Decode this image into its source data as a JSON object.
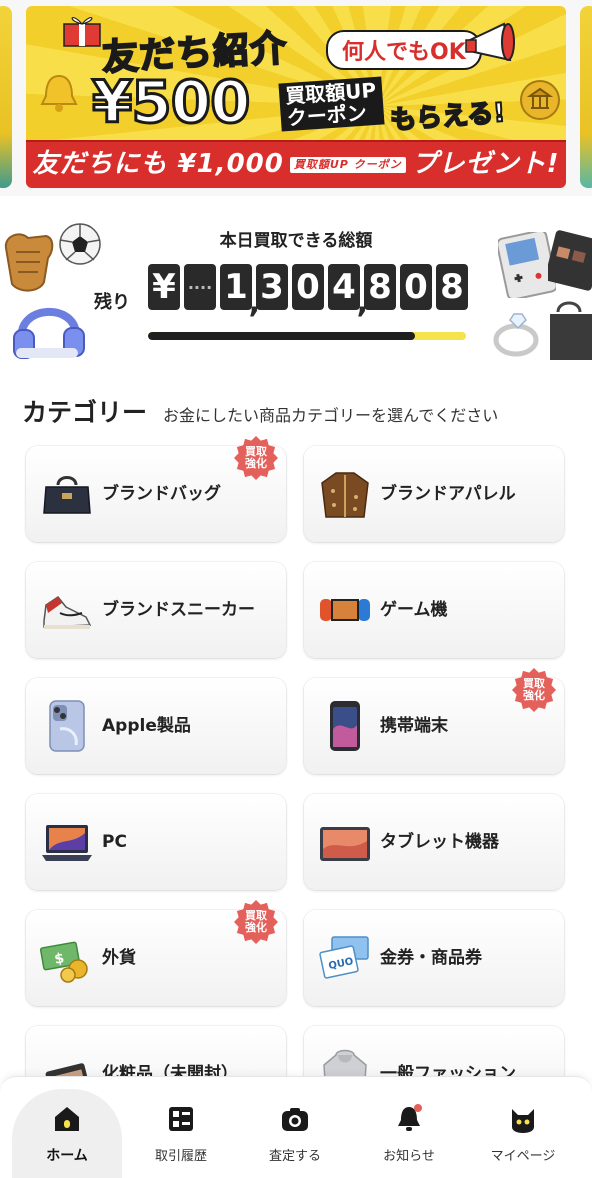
{
  "banner": {
    "headline": "友だち紹介",
    "pill": "何人でもOK",
    "amount": "¥500",
    "coupon_tag_line1": "買取額UP",
    "coupon_tag_line2": "クーポン",
    "receive": "もらえる!",
    "ribbon_prefix": "友だちにも ¥1,000",
    "ribbon_tag": "買取額UP クーポン",
    "ribbon_suffix": "プレゼント!"
  },
  "totals": {
    "title": "本日買取できる総額",
    "remaining_label": "残り",
    "digits": [
      "¥",
      "····",
      "1",
      "3",
      "0",
      "4",
      "8",
      "0",
      "8"
    ],
    "progress_fraction": 0.84
  },
  "category": {
    "title": "カテゴリー",
    "subtitle": "お金にしたい商品カテゴリーを選んでください",
    "badge_line1": "買取",
    "badge_line2": "強化",
    "items": [
      {
        "label": "ブランドバッグ",
        "icon": "handbag-icon",
        "badge": true
      },
      {
        "label": "ブランドアパレル",
        "icon": "jacket-icon",
        "badge": false
      },
      {
        "label": "ブランドスニーカー",
        "icon": "sneaker-icon",
        "badge": false
      },
      {
        "label": "ゲーム機",
        "icon": "game-console-icon",
        "badge": false
      },
      {
        "label": "Apple製品",
        "icon": "iphone-icon",
        "badge": false
      },
      {
        "label": "携帯端末",
        "icon": "smartphone-icon",
        "badge": true
      },
      {
        "label": "PC",
        "icon": "laptop-icon",
        "badge": false
      },
      {
        "label": "タブレット機器",
        "icon": "tablet-icon",
        "badge": false
      },
      {
        "label": "外貨",
        "icon": "currency-icon",
        "badge": true
      },
      {
        "label": "金券・商品券",
        "icon": "gift-card-icon",
        "badge": false
      },
      {
        "label": "化粧品（未開封）",
        "icon": "cosmetics-icon",
        "badge": false
      },
      {
        "label": "一般ファッション",
        "icon": "hoodie-icon",
        "badge": false
      }
    ]
  },
  "nav": {
    "items": [
      {
        "label": "ホーム",
        "icon": "home-icon",
        "active": true
      },
      {
        "label": "取引履歴",
        "icon": "history-icon",
        "active": false
      },
      {
        "label": "査定する",
        "icon": "camera-icon",
        "active": false
      },
      {
        "label": "お知らせ",
        "icon": "bell-icon",
        "active": false
      },
      {
        "label": "マイページ",
        "icon": "cat-avatar-icon",
        "active": false
      }
    ]
  },
  "colors": {
    "accent_yellow": "#f6e24a",
    "badge_red": "#e4605b",
    "ribbon_red": "#d92f2c",
    "dark": "#2a2a2a"
  }
}
